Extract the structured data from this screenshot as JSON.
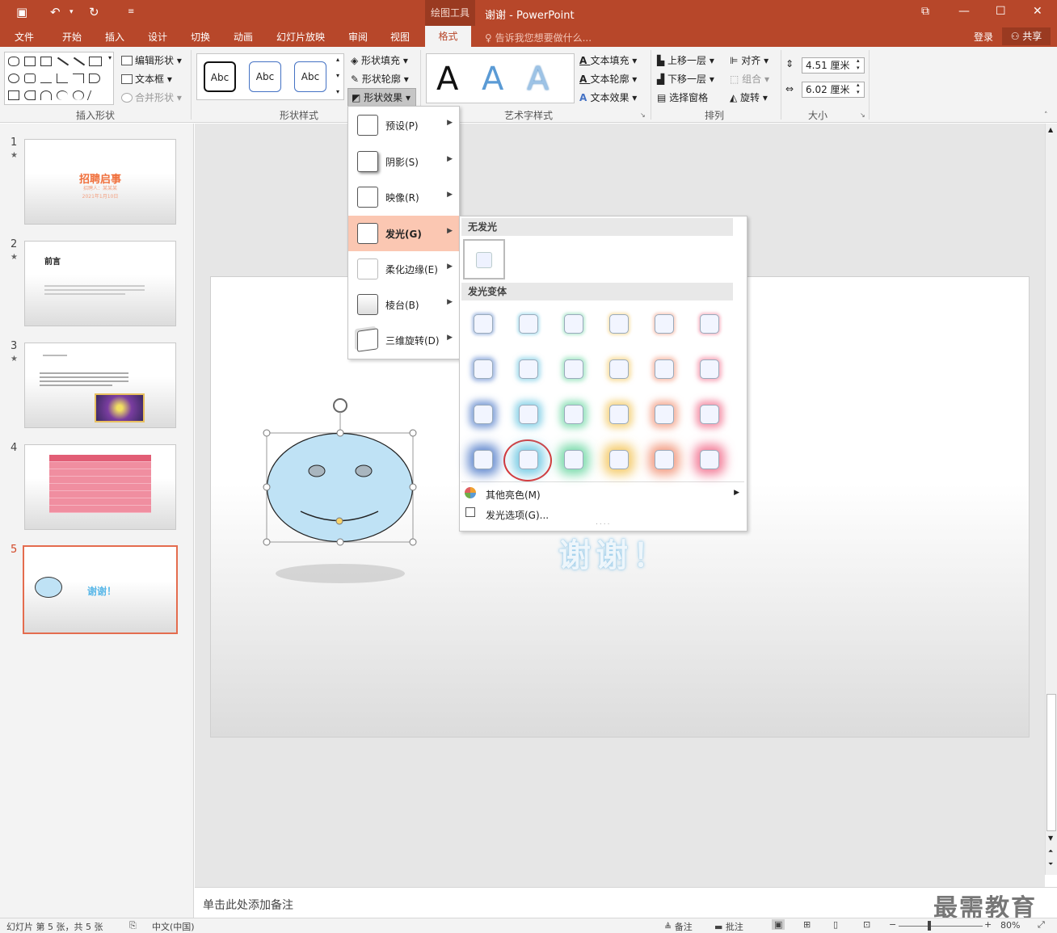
{
  "titlebar": {
    "context_tab": "绘图工具",
    "title": "谢谢 - PowerPoint"
  },
  "tabs": [
    "文件",
    "开始",
    "插入",
    "设计",
    "切换",
    "动画",
    "幻灯片放映",
    "审阅",
    "视图"
  ],
  "active_tab": "格式",
  "tell_me": "告诉我您想要做什么...",
  "login": "登录",
  "share": "共享",
  "ribbon": {
    "insert_shapes": {
      "label": "插入形状",
      "edit_shape": "编辑形状",
      "text_box": "文本框",
      "merge_shapes": "合并形状"
    },
    "shape_styles": {
      "label": "形状样式",
      "abc": "Abc",
      "fill": "形状填充",
      "outline": "形状轮廓",
      "effects": "形状效果"
    },
    "wordart": {
      "label": "艺术字样式",
      "a": "A",
      "text_fill": "文本填充",
      "text_outline": "文本轮廓",
      "text_effects": "文本效果"
    },
    "arrange": {
      "label": "排列",
      "bring_forward": "上移一层",
      "send_backward": "下移一层",
      "selection_pane": "选择窗格",
      "align": "对齐",
      "group": "组合",
      "rotate": "旋转"
    },
    "size": {
      "label": "大小",
      "height": "4.51 厘米",
      "width": "6.02 厘米"
    }
  },
  "slides": [
    {
      "num": "1",
      "title": "招聘启事",
      "sub": "招聘人：某某某",
      "date": "2021年1月10日"
    },
    {
      "num": "2",
      "title": "前言"
    },
    {
      "num": "3"
    },
    {
      "num": "4"
    },
    {
      "num": "5",
      "text": "谢谢！"
    }
  ],
  "effects_menu": [
    {
      "label": "预设(P)"
    },
    {
      "label": "阴影(S)"
    },
    {
      "label": "映像(R)"
    },
    {
      "label": "发光(G)"
    },
    {
      "label": "柔化边缘(E)"
    },
    {
      "label": "棱台(B)"
    },
    {
      "label": "三维旋转(D)"
    }
  ],
  "glow_menu": {
    "no_glow": "无发光",
    "variants": "发光变体",
    "more_colors": "其他亮色(M)",
    "options": "发光选项(G)...",
    "colors": [
      "#4472c4",
      "#5bc0de",
      "#5fd39a",
      "#f2c14e",
      "#f08a6a",
      "#f06383"
    ]
  },
  "notes_placeholder": "单击此处添加备注",
  "status": {
    "slide_info": "幻灯片 第 5 张，共 5 张",
    "language": "中文(中国)",
    "notes": "备注",
    "comments": "批注",
    "zoom": "80%"
  },
  "watermark": "最需教育"
}
